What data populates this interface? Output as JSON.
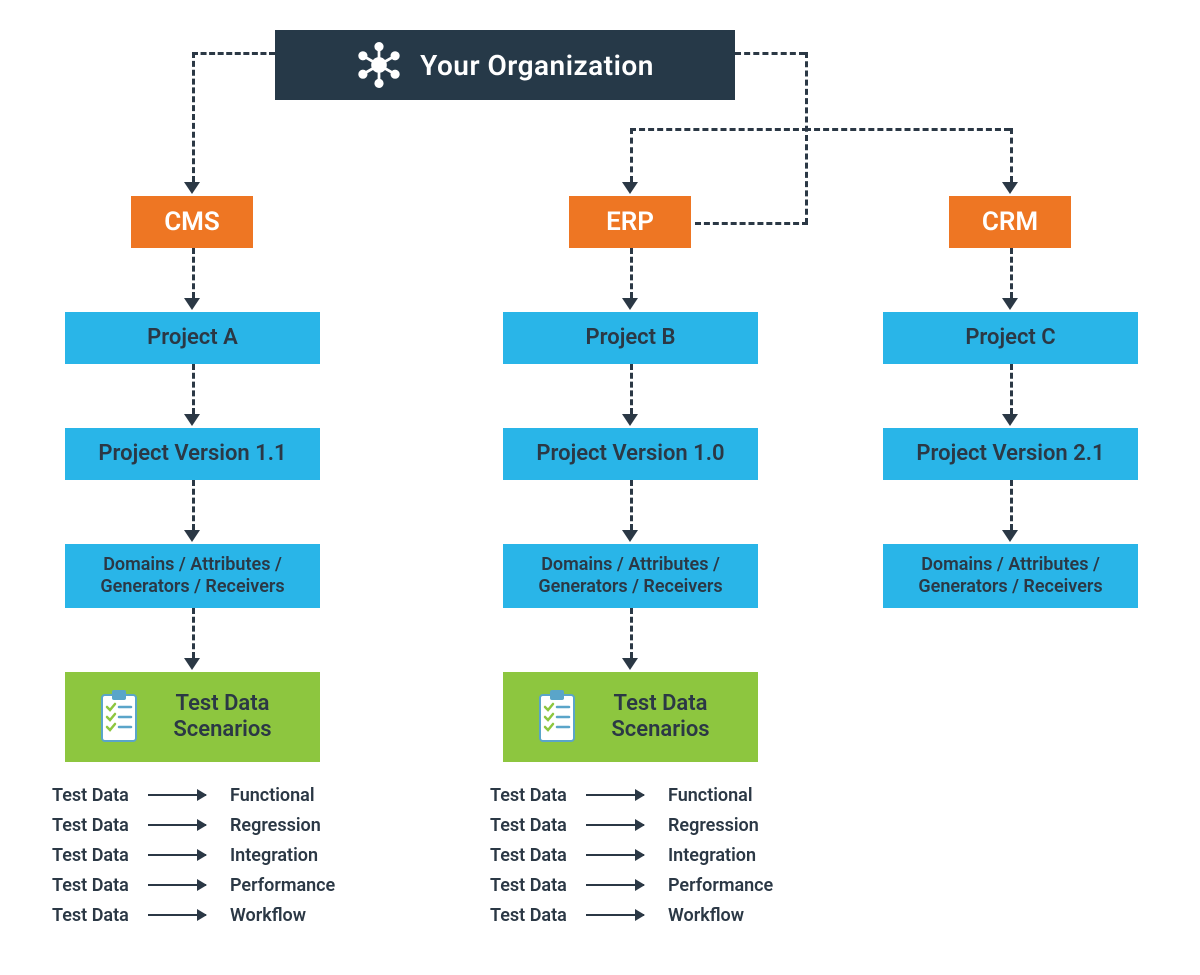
{
  "org": {
    "title": "Your Organization"
  },
  "systems": {
    "cms": {
      "label": "CMS"
    },
    "erp": {
      "label": "ERP"
    },
    "crm": {
      "label": "CRM"
    }
  },
  "projects": {
    "a": "Project A",
    "b": "Project B",
    "c": "Project C"
  },
  "versions": {
    "a": "Project Version 1.1",
    "b": "Project Version 1.0",
    "c": "Project Version 2.1"
  },
  "components_label": "Domains /  Attributes / Generators / Receivers",
  "scenarios_label": "Test Data Scenarios",
  "test_label": "Test Data",
  "test_types": [
    "Functional",
    "Regression",
    "Integration",
    "Performance",
    "Workflow"
  ],
  "colors": {
    "dark": "#263948",
    "orange": "#ee7623",
    "blue": "#29b5e8",
    "green": "#8dc63f"
  }
}
